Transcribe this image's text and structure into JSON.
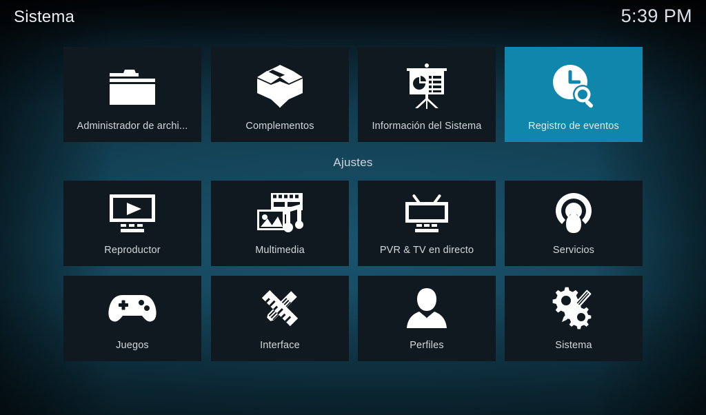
{
  "header": {
    "title": "Sistema",
    "clock": "5:39 PM"
  },
  "colors": {
    "focus_highlight": "#0f86ab",
    "tile_background": "#101820",
    "label_text": "#d3d8db",
    "title_text": "#e9eef1",
    "background_teal": "#0c2734"
  },
  "section_divider": {
    "label": "Ajustes"
  },
  "grid": {
    "row1": [
      {
        "label": "Administrador de archi...",
        "icon": "folder-icon",
        "focused": false
      },
      {
        "label": "Complementos",
        "icon": "open-box-icon",
        "focused": false
      },
      {
        "label": "Información del Sistema",
        "icon": "presentation-board-icon",
        "focused": false
      },
      {
        "label": "Registro de eventos",
        "icon": "clock-search-icon",
        "focused": true
      }
    ],
    "row2": [
      {
        "label": "Reproductor",
        "icon": "monitor-play-icon",
        "focused": false
      },
      {
        "label": "Multimedia",
        "icon": "film-photo-music-icon",
        "focused": false
      },
      {
        "label": "PVR & TV en directo",
        "icon": "television-antenna-icon",
        "focused": false
      },
      {
        "label": "Servicios",
        "icon": "broadcast-person-icon",
        "focused": false
      }
    ],
    "row3": [
      {
        "label": "Juegos",
        "icon": "gamepad-icon",
        "focused": false
      },
      {
        "label": "Interface",
        "icon": "pencil-ruler-icon",
        "focused": false
      },
      {
        "label": "Perfiles",
        "icon": "person-silhouette-icon",
        "focused": false
      },
      {
        "label": "Sistema",
        "icon": "gears-screwdriver-icon",
        "focused": false
      }
    ]
  }
}
